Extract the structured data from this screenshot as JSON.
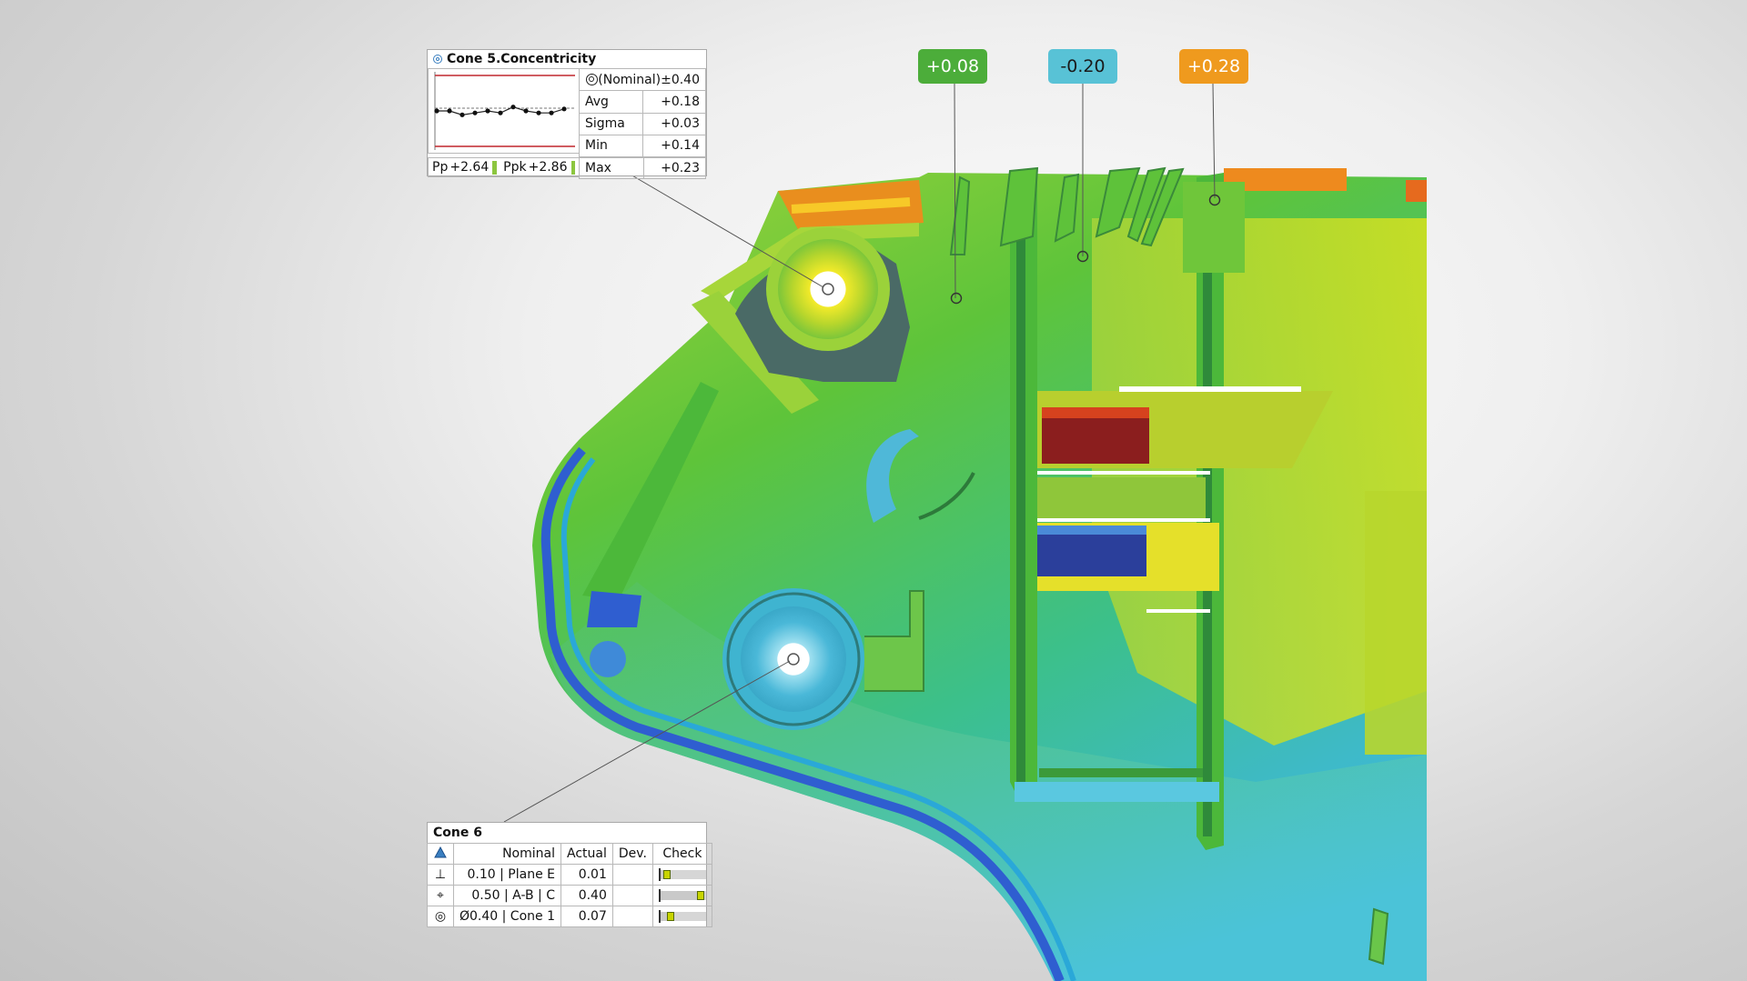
{
  "colors": {
    "tag_green": "#4cad3a",
    "tag_cyan": "#58c2d6",
    "tag_orange": "#ef9a1e",
    "nominal_limit": "#c0272d",
    "indicator_green": "#8cc63f"
  },
  "deviation_tags": [
    {
      "label": "+0.08",
      "color": "#4cad3a"
    },
    {
      "label": "-0.20",
      "color": "#58c2d6"
    },
    {
      "label": "+0.28",
      "color": "#ef9a1e"
    }
  ],
  "cone5": {
    "title": "Cone 5.Concentricity",
    "icon": "concentricity-icon",
    "nominal_label": "(Nominal)±0.40",
    "stats": [
      {
        "label": "Avg",
        "value": "+0.18"
      },
      {
        "label": "Sigma",
        "value": "+0.03"
      },
      {
        "label": "Min",
        "value": "+0.14"
      },
      {
        "label": "Max",
        "value": "+0.23"
      }
    ],
    "pp_label": "Pp",
    "pp_value": "+2.64",
    "ppk_label": "Ppk",
    "ppk_value": "+2.86",
    "trend_values": [
      0.18,
      0.18,
      0.16,
      0.17,
      0.18,
      0.17,
      0.2,
      0.18,
      0.17,
      0.17,
      0.19
    ]
  },
  "cone6": {
    "title": "Cone 6",
    "headers": {
      "nominal": "Nominal",
      "actual": "Actual",
      "dev": "Dev.",
      "check": "Check"
    },
    "rows": [
      {
        "symbol": "⊥",
        "symbol_name": "perpendicularity-icon",
        "nominal": "0.10 | Plane E",
        "actual": "0.01",
        "dev": "",
        "check_fraction": 0.1
      },
      {
        "symbol": "⌖",
        "symbol_name": "position-icon",
        "nominal": "0.50 | A-B | C",
        "actual": "0.40",
        "dev": "",
        "check_fraction": 0.8
      },
      {
        "symbol": "◎",
        "symbol_name": "concentricity-icon",
        "nominal": "Ø0.40 | Cone 1",
        "actual": "0.07",
        "dev": "",
        "check_fraction": 0.175
      }
    ]
  }
}
